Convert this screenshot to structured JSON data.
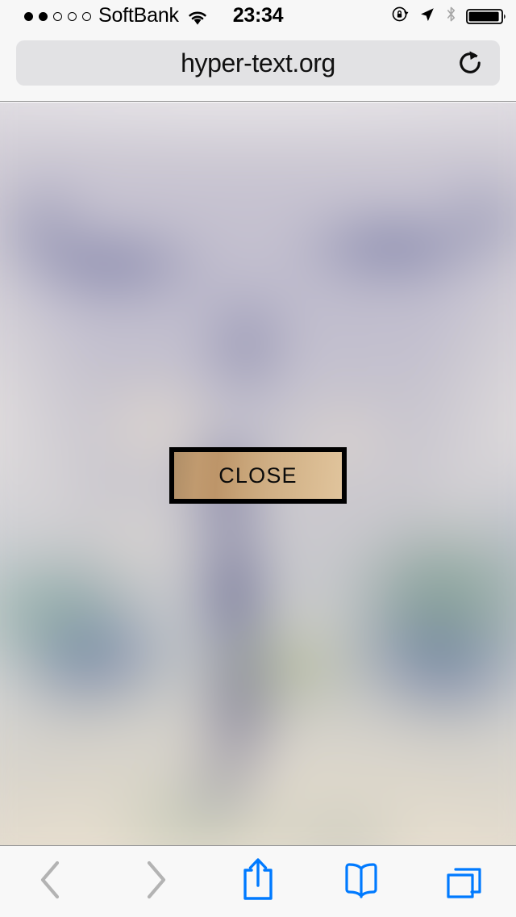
{
  "status_bar": {
    "signal_dots_total": 5,
    "signal_dots_filled": 2,
    "carrier": "SoftBank",
    "wifi_icon": "wifi-icon",
    "time": "23:34",
    "rotation_lock_icon": "rotation-lock-icon",
    "location_icon": "location-arrow-icon",
    "bluetooth_icon": "bluetooth-icon",
    "battery_icon": "battery-icon",
    "battery_level_percent": 88
  },
  "browser": {
    "url": "hyper-text.org",
    "url_placeholder": "Search or enter website name",
    "reload_icon": "reload-icon"
  },
  "content": {
    "type": "blurred-photograph",
    "description": "heavily blurred image"
  },
  "overlay": {
    "close_button_label": "CLOSE"
  },
  "toolbar": {
    "items": [
      {
        "name": "back-button",
        "icon": "chevron-left-icon",
        "enabled": false
      },
      {
        "name": "forward-button",
        "icon": "chevron-right-icon",
        "enabled": false
      },
      {
        "name": "share-button",
        "icon": "share-icon",
        "enabled": true
      },
      {
        "name": "bookmarks-button",
        "icon": "book-icon",
        "enabled": true
      },
      {
        "name": "tabs-button",
        "icon": "tabs-icon",
        "enabled": true
      }
    ]
  },
  "colors": {
    "accent_blue": "#007aff",
    "disabled_gray": "#b3b3b3",
    "chrome_background": "#f7f7f7",
    "url_field_background": "#e2e2e4",
    "button_border": "#000000",
    "button_fill_dark": "#b08f68",
    "button_fill_light": "#e0c49c"
  }
}
